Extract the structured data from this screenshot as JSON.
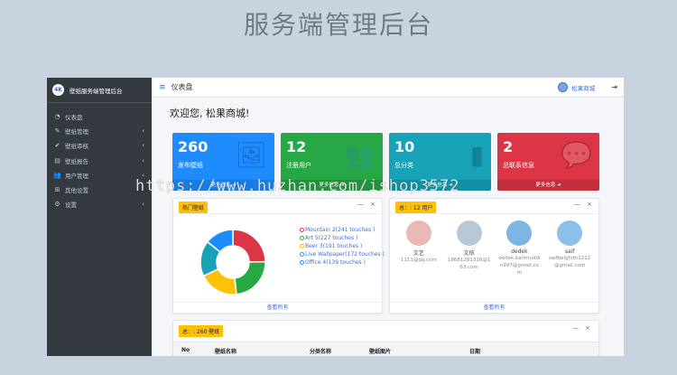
{
  "banner": "服务端管理后台",
  "app": {
    "brand": {
      "logo_text": "4K",
      "title": "壁纸服务端管理后台"
    },
    "sidebar": {
      "items": [
        {
          "label": "仪表盘",
          "icon": "dashboard-icon",
          "glyph": "◔",
          "chevron": false
        },
        {
          "label": "壁纸管理",
          "icon": "edit-icon",
          "glyph": "✎",
          "chevron": true
        },
        {
          "label": "壁纸审核",
          "icon": "check-circle-icon",
          "glyph": "✔",
          "chevron": true
        },
        {
          "label": "壁纸报告",
          "icon": "report-icon",
          "glyph": "▤",
          "chevron": true
        },
        {
          "label": "用户管理",
          "icon": "users-icon",
          "glyph": "👥",
          "chevron": true
        },
        {
          "label": "其他设置",
          "icon": "plus-square-icon",
          "glyph": "⊞",
          "chevron": false
        },
        {
          "label": "设置",
          "icon": "gears-icon",
          "glyph": "⚙",
          "chevron": true
        }
      ],
      "chevron_glyph": "‹"
    },
    "topbar": {
      "menu_glyph": "≡",
      "title": "仪表盘",
      "user": "松果商城",
      "logout_glyph": "⇥"
    },
    "welcome": "欢迎您, 松果商城!",
    "stats": [
      {
        "value": "260",
        "label": "发布壁纸",
        "footer": "更多信息 ➜",
        "icon": "image-icon",
        "glyph": "🖼",
        "color": "#1e8cff"
      },
      {
        "value": "12",
        "label": "注册用户",
        "footer": "更多信息 ➜",
        "icon": "users-icon",
        "glyph": "👥",
        "color": "#28a745"
      },
      {
        "value": "10",
        "label": "总分类",
        "footer": "更多信息 ➜",
        "icon": "bar-chart-icon",
        "glyph": "▮",
        "color": "#17a2b8"
      },
      {
        "value": "2",
        "label": "总联系信息",
        "footer": "更多信息 ➜",
        "icon": "comment-icon",
        "glyph": "💬",
        "color": "#dc3545"
      }
    ],
    "hot_card": {
      "badge": "热门壁纸",
      "minimize_glyph": "—",
      "close_glyph": "×",
      "footer": "查看所有"
    },
    "chart_data": {
      "type": "pie",
      "categories": [
        "Mountain",
        "Art",
        "Beer",
        "Live Wallpaper",
        "Office"
      ],
      "values": [
        241,
        227,
        191,
        172,
        139
      ],
      "legend": [
        "Mountain 2(241 touches )",
        "Art 5(227 touches )",
        "Beer 3(191 touches )",
        "Live Wallpaper(172 touches )",
        "Office 4(139 touches )"
      ],
      "colors": [
        "#dc3545",
        "#28a745",
        "#ffc107",
        "#17a2b8",
        "#1e8cff"
      ],
      "legend_position": "right"
    },
    "users_card": {
      "badge": "总：: 12 用户",
      "footer": "查看所有",
      "users": [
        {
          "name": "文艺",
          "email": "1111@qq.com",
          "color": "#e9b9b5"
        },
        {
          "name": "文依",
          "email": "18681281316@163.com",
          "color": "#b8c9d6"
        },
        {
          "name": "dedek",
          "email": "dedek.karimuddin997@gmail.com",
          "color": "#7fb5e2"
        },
        {
          "name": "saif",
          "email": "saifbelghith1212@gmail.com",
          "color": "#8dc0e8"
        }
      ]
    },
    "wallpaper_card": {
      "badge": "总：: 260 壁纸",
      "columns": [
        "No",
        "壁纸名称",
        "分类名称",
        "壁纸图片",
        "日期"
      ]
    }
  },
  "watermark": "https://www.huzhan.com/ishop3572"
}
